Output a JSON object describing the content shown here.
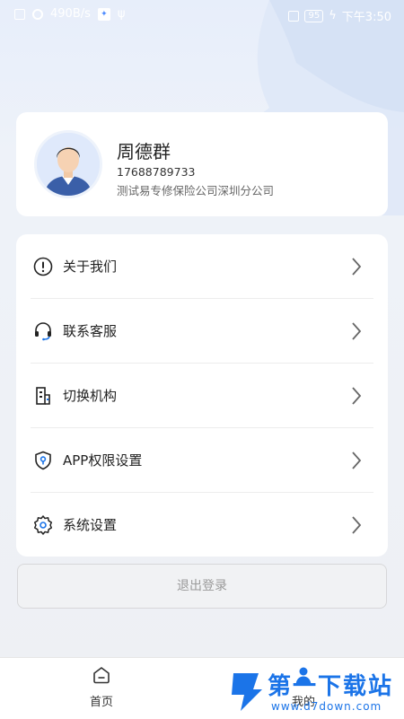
{
  "status_bar": {
    "network_speed": "490B/s",
    "battery": "95",
    "time": "下午3:50"
  },
  "profile": {
    "name": "周德群",
    "phone": "17688789733",
    "org": "测试易专修保险公司深圳分公司"
  },
  "menu": {
    "items": [
      {
        "label": "关于我们",
        "icon": "info-icon"
      },
      {
        "label": "联系客服",
        "icon": "headset-icon"
      },
      {
        "label": "切换机构",
        "icon": "building-icon"
      },
      {
        "label": "APP权限设置",
        "icon": "shield-icon"
      },
      {
        "label": "系统设置",
        "icon": "gear-icon"
      }
    ]
  },
  "logout_label": "退出登录",
  "bottom_nav": {
    "items": [
      {
        "label": "首页",
        "icon": "home-icon"
      },
      {
        "label": "我的",
        "icon": "person-icon"
      }
    ]
  },
  "watermark": {
    "title": "第一下载站",
    "url": "www.d7down.com"
  },
  "colors": {
    "accent": "#1b74e8",
    "card": "#ffffff",
    "background": "#eef1f6"
  }
}
